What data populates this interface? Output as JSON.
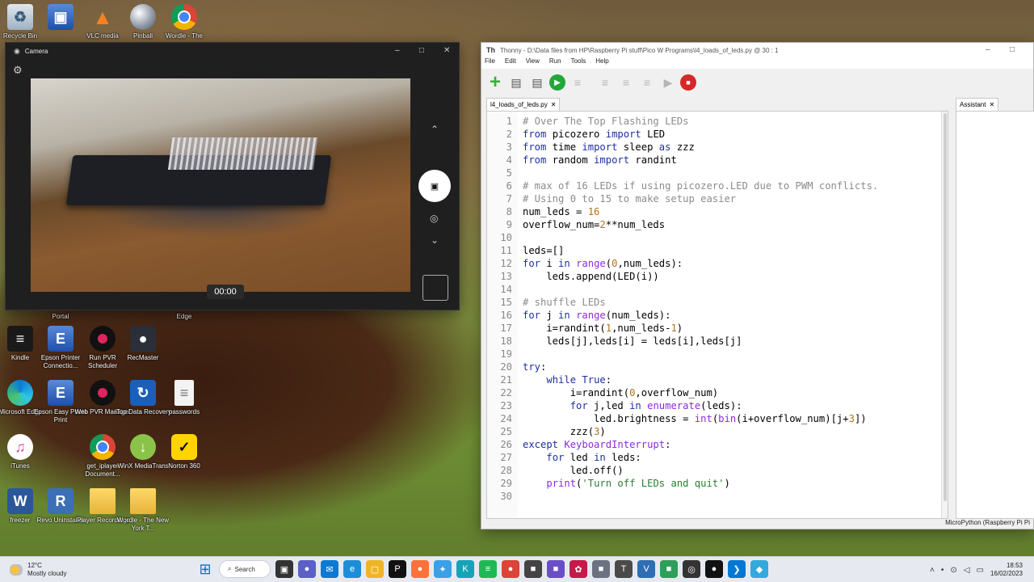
{
  "desktop": {
    "icons": [
      {
        "label": "Recycle Bin",
        "glyph": "♻"
      },
      {
        "label": "",
        "glyph": "▣"
      },
      {
        "label": "VLC media",
        "glyph": "▲"
      },
      {
        "label": "Pinball",
        "glyph": ""
      },
      {
        "label": "Wordle - The",
        "glyph": ""
      },
      {
        "label": "Portal",
        "glyph": ""
      },
      {
        "label": "Edge",
        "glyph": ""
      },
      {
        "label": "Kindle",
        "glyph": "≡"
      },
      {
        "label": "Epson Printer Connectio...",
        "glyph": "E"
      },
      {
        "label": "Run PVR Scheduler",
        "glyph": ""
      },
      {
        "label": "RecMaster",
        "glyph": "●"
      },
      {
        "label": "Microsoft Edge",
        "glyph": ""
      },
      {
        "label": "Epson Easy Photo Print",
        "glyph": "E"
      },
      {
        "label": "Web PVR Manager",
        "glyph": ""
      },
      {
        "label": "iTop Data Recovery",
        "glyph": "↻"
      },
      {
        "label": "passwords",
        "glyph": "≡"
      },
      {
        "label": "iTunes",
        "glyph": "♫"
      },
      {
        "label": "get_iplayer Document...",
        "glyph": ""
      },
      {
        "label": "WinX MediaTrans",
        "glyph": "↓"
      },
      {
        "label": "Norton 360",
        "glyph": "✓"
      },
      {
        "label": "freezer",
        "glyph": "W"
      },
      {
        "label": "Revo Uninstaller",
        "glyph": "R"
      },
      {
        "label": "iPlayer Recordings",
        "glyph": ""
      },
      {
        "label": "Wordle - The New York T...",
        "glyph": ""
      }
    ]
  },
  "camera": {
    "title": "Camera",
    "timer": "00:00",
    "icons": {
      "settings": "⚙",
      "minimize": "–",
      "maximize": "□",
      "close": "✕",
      "up": "⌃",
      "down": "⌄",
      "video": "▣",
      "photo": "◎"
    }
  },
  "thonny": {
    "title": "Thonny  -  D:\\Data files from HP\\Raspberry Pi stuff\\Pico W Programs\\l4_loads_of_leds.py  @  30 : 1",
    "logo": "Th",
    "menu": [
      "File",
      "Edit",
      "View",
      "Run",
      "Tools",
      "Help"
    ],
    "tab": "l4_loads_of_leds.py",
    "assistant_tab": "Assistant",
    "status": "MicroPython (Raspberry Pi Pi",
    "window_ctrl": {
      "minimize": "–",
      "maximize": "□"
    },
    "toolbar": {
      "new": "+",
      "open": "▤",
      "save": "▤",
      "run": "▶",
      "debug": "≡",
      "step_over": "≡",
      "step_into": "≡",
      "step_out": "≡",
      "resume": "▶",
      "stop": "■"
    },
    "code": [
      [
        [
          "cm",
          "# Over The Top Flashing LEDs"
        ]
      ],
      [
        [
          "kw",
          "from"
        ],
        [
          "",
          " picozero "
        ],
        [
          "kw",
          "import"
        ],
        [
          "",
          " LED"
        ]
      ],
      [
        [
          "kw",
          "from"
        ],
        [
          "",
          " time "
        ],
        [
          "kw",
          "import"
        ],
        [
          "",
          " sleep "
        ],
        [
          "kw",
          "as"
        ],
        [
          "",
          " zzz"
        ]
      ],
      [
        [
          "kw",
          "from"
        ],
        [
          "",
          " random "
        ],
        [
          "kw",
          "import"
        ],
        [
          "",
          " randint"
        ]
      ],
      [],
      [
        [
          "cm",
          "# max of 16 LEDs if using picozero.LED due to PWM conflicts."
        ]
      ],
      [
        [
          "cm",
          "# Using 0 to 15 to make setup easier"
        ]
      ],
      [
        [
          "",
          "num_leds = "
        ],
        [
          "num",
          "16"
        ]
      ],
      [
        [
          "",
          "overflow_num="
        ],
        [
          "num",
          "2"
        ],
        [
          "",
          "**num_leds"
        ]
      ],
      [],
      [
        [
          "",
          "leds=[]"
        ]
      ],
      [
        [
          "kw",
          "for"
        ],
        [
          "",
          " i "
        ],
        [
          "kw",
          "in"
        ],
        [
          "",
          " "
        ],
        [
          "bi",
          "range"
        ],
        [
          "",
          "("
        ],
        [
          "num",
          "0"
        ],
        [
          "",
          ",num_leds):"
        ]
      ],
      [
        [
          "",
          "    leds.append(LED(i))"
        ]
      ],
      [],
      [
        [
          "cm",
          "# shuffle LEDs"
        ]
      ],
      [
        [
          "kw",
          "for"
        ],
        [
          "",
          " j "
        ],
        [
          "kw",
          "in"
        ],
        [
          "",
          " "
        ],
        [
          "bi",
          "range"
        ],
        [
          "",
          "(num_leds):"
        ]
      ],
      [
        [
          "",
          "    i=randint("
        ],
        [
          "num",
          "1"
        ],
        [
          "",
          ",num_leds-"
        ],
        [
          "num",
          "1"
        ],
        [
          "",
          ")"
        ]
      ],
      [
        [
          "",
          "    leds[j],leds[i] = leds[i],leds[j]"
        ]
      ],
      [],
      [
        [
          "kw",
          "try"
        ],
        [
          "",
          ":"
        ]
      ],
      [
        [
          "",
          "    "
        ],
        [
          "kw",
          "while"
        ],
        [
          "",
          " "
        ],
        [
          "kw",
          "True"
        ],
        [
          "",
          ":"
        ]
      ],
      [
        [
          "",
          "        i=randint("
        ],
        [
          "num",
          "0"
        ],
        [
          "",
          ",overflow_num)"
        ]
      ],
      [
        [
          "",
          "        "
        ],
        [
          "kw",
          "for"
        ],
        [
          "",
          " j,led "
        ],
        [
          "kw",
          "in"
        ],
        [
          "",
          " "
        ],
        [
          "bi",
          "enumerate"
        ],
        [
          "",
          "(leds):"
        ]
      ],
      [
        [
          "",
          "            led.brightness = "
        ],
        [
          "bi",
          "int"
        ],
        [
          "",
          "("
        ],
        [
          "bi",
          "bin"
        ],
        [
          "",
          "(i+overflow_num)[j+"
        ],
        [
          "num",
          "3"
        ],
        [
          "",
          "])"
        ]
      ],
      [
        [
          "",
          "        zzz("
        ],
        [
          "num",
          "3"
        ],
        [
          "",
          ")"
        ]
      ],
      [
        [
          "kw",
          "except"
        ],
        [
          "",
          " "
        ],
        [
          "bi",
          "KeyboardInterrupt"
        ],
        [
          "",
          ":"
        ]
      ],
      [
        [
          "",
          "    "
        ],
        [
          "kw",
          "for"
        ],
        [
          "",
          " led "
        ],
        [
          "kw",
          "in"
        ],
        [
          "",
          " leds:"
        ]
      ],
      [
        [
          "",
          "        led.off()"
        ]
      ],
      [
        [
          "",
          "    "
        ],
        [
          "bi",
          "print"
        ],
        [
          "",
          "("
        ],
        [
          "str",
          "'Turn off LEDs and quit'"
        ],
        [
          "",
          ")"
        ]
      ],
      []
    ]
  },
  "taskbar": {
    "weather_temp": "12°C",
    "weather_desc": "Mostly cloudy",
    "search_label": "Search",
    "start_icon": "⊞",
    "search_icon": "⌕",
    "time": "18:53",
    "date": "16/02/2023",
    "tray": {
      "chevron": "˄",
      "mic": "•",
      "network": "⊙",
      "volume": "◁",
      "battery": "▭"
    },
    "apps": [
      {
        "name": "task-view",
        "glyph": "▣",
        "color": "#333333"
      },
      {
        "name": "teams",
        "glyph": "●",
        "color": "#5b5fc7"
      },
      {
        "name": "mail",
        "glyph": "✉",
        "color": "#0a7ad4"
      },
      {
        "name": "edge",
        "glyph": "e",
        "color": "#1c8ed9"
      },
      {
        "name": "files",
        "glyph": "▢",
        "color": "#f0b429"
      },
      {
        "name": "pvr",
        "glyph": "P",
        "color": "#111111"
      },
      {
        "name": "firefox",
        "glyph": "●",
        "color": "#ff7139"
      },
      {
        "name": "app-blue",
        "glyph": "✦",
        "color": "#3aa0e8"
      },
      {
        "name": "kodi",
        "glyph": "K",
        "color": "#17a2b8"
      },
      {
        "name": "spotify",
        "glyph": "≡",
        "color": "#1db954"
      },
      {
        "name": "chrome",
        "glyph": "●",
        "color": "#db4437"
      },
      {
        "name": "app-dark",
        "glyph": "■",
        "color": "#444444"
      },
      {
        "name": "app-purple",
        "glyph": "■",
        "color": "#6a4ec8"
      },
      {
        "name": "raspberry",
        "glyph": "✿",
        "color": "#c51a4a"
      },
      {
        "name": "app-grey",
        "glyph": "■",
        "color": "#6b7280"
      },
      {
        "name": "thonny",
        "glyph": "T",
        "color": "#4a4a4a"
      },
      {
        "name": "ve",
        "glyph": "V",
        "color": "#2f6db5"
      },
      {
        "name": "app-green",
        "glyph": "■",
        "color": "#2e9e5b"
      },
      {
        "name": "camera",
        "glyph": "◎",
        "color": "#333333"
      },
      {
        "name": "recorder",
        "glyph": "●",
        "color": "#111111"
      },
      {
        "name": "vscode",
        "glyph": "❯",
        "color": "#0078d4"
      },
      {
        "name": "app-cyan",
        "glyph": "◆",
        "color": "#33a9dc"
      }
    ]
  }
}
